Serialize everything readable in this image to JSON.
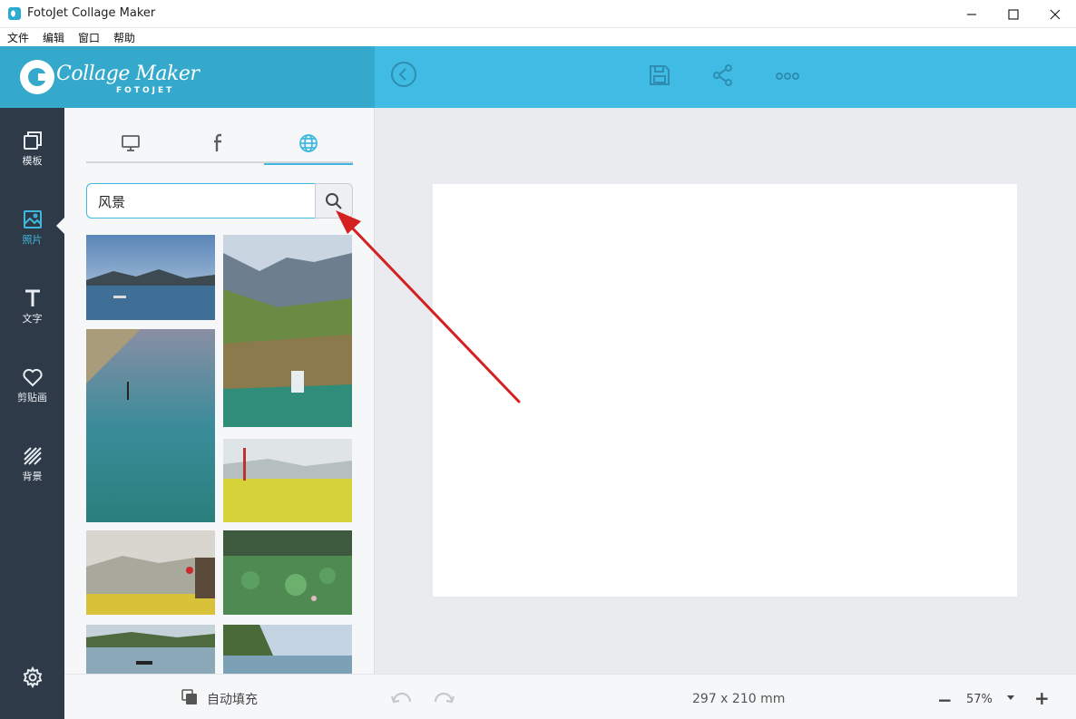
{
  "window": {
    "title": "FotoJet Collage Maker"
  },
  "menu": {
    "items": [
      "文件",
      "编辑",
      "窗口",
      "帮助"
    ]
  },
  "header": {
    "logo_text": "Collage Maker",
    "logo_sub": "FOTOJET",
    "icons": [
      "back-icon",
      "save-icon",
      "share-icon",
      "more-icon"
    ]
  },
  "nav": {
    "items": [
      {
        "label": "模板",
        "icon": "template-icon"
      },
      {
        "label": "照片",
        "icon": "photo-icon",
        "active": true
      },
      {
        "label": "文字",
        "icon": "text-icon"
      },
      {
        "label": "剪贴画",
        "icon": "clipart-icon"
      },
      {
        "label": "背景",
        "icon": "background-icon"
      }
    ],
    "settings_icon": "gear-icon"
  },
  "panel": {
    "tabs": [
      {
        "icon": "computer-icon"
      },
      {
        "icon": "facebook-icon"
      },
      {
        "icon": "globe-icon",
        "active": true
      }
    ],
    "search_value": "风景",
    "autofill_label": "自动填充"
  },
  "canvas": {
    "size_label": "297 x 210 mm",
    "zoom": "57%"
  },
  "colors": {
    "header": "#40bce4",
    "accent": "#3fb8e0",
    "nav": "#2f3a49",
    "annotation_arrow": "#d42020"
  }
}
